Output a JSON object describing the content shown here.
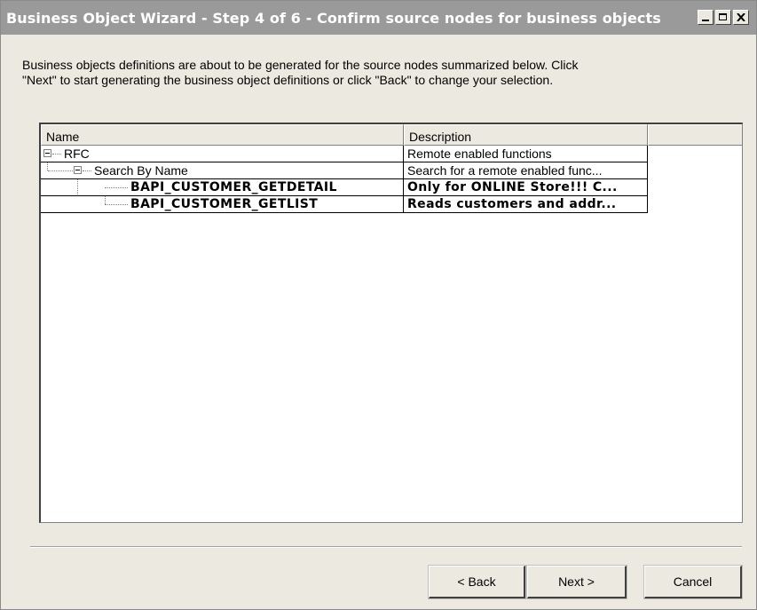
{
  "window": {
    "title": "Business Object Wizard - Step 4 of 6 - Confirm source nodes for business objects",
    "controls": [
      "minimize-icon",
      "maximize-icon",
      "close-icon"
    ]
  },
  "intro": {
    "line1": "Business objects definitions are about to be generated for the source nodes summarized below. Click",
    "line2": "\"Next\" to start generating the business object definitions or click \"Back\" to change your selection."
  },
  "tree": {
    "columns": [
      "Name",
      "Description"
    ],
    "rows": [
      {
        "name": "RFC",
        "description": "Remote enabled functions",
        "level": 0,
        "bold": false,
        "expanded": true
      },
      {
        "name": "Search By Name",
        "description": "Search for a remote enabled func...",
        "level": 1,
        "bold": false,
        "expanded": true
      },
      {
        "name": "BAPI_CUSTOMER_GETDETAIL",
        "description": "Only for ONLINE Store!!! C...",
        "level": 2,
        "bold": true
      },
      {
        "name": "BAPI_CUSTOMER_GETLIST",
        "description": "Reads customers and addr...",
        "level": 2,
        "bold": true
      }
    ]
  },
  "buttons": {
    "back": "< Back",
    "next": "Next >",
    "cancel": "Cancel"
  }
}
